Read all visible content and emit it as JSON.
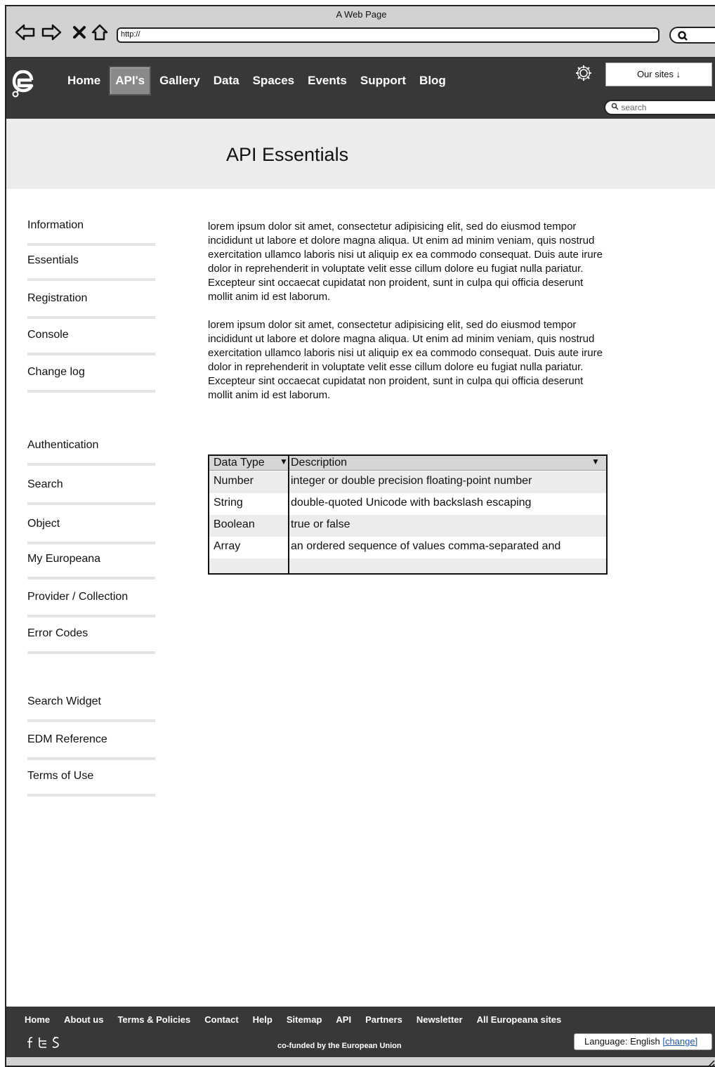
{
  "browser": {
    "window_title": "A Web Page",
    "url": "http://"
  },
  "header": {
    "nav": [
      "Home",
      "API's",
      "Gallery",
      "Data",
      "Spaces",
      "Events",
      "Support",
      "Blog"
    ],
    "active_nav": "API's",
    "our_sites": "Our sites ↓",
    "search_placeholder": "search"
  },
  "page": {
    "title": "API Essentials"
  },
  "sidebar": {
    "items": [
      "Information",
      "Essentials",
      "Registration",
      "Console",
      "Change log",
      "Authentication",
      "Search",
      "Object",
      "My Europeana",
      "Provider / Collection",
      "Error Codes",
      "Search Widget",
      "EDM Reference",
      "Terms of Use"
    ]
  },
  "content": {
    "paragraphs": [
      "lorem ipsum dolor sit amet, consectetur adipisicing elit, sed do eiusmod tempor incididunt ut labore et dolore magna aliqua. Ut enim ad minim veniam, quis nostrud exercitation ullamco laboris nisi ut aliquip ex ea commodo consequat. Duis aute irure dolor in reprehenderit in voluptate velit esse cillum dolore eu fugiat nulla pariatur. Excepteur sint occaecat cupidatat non proident, sunt in culpa qui officia deserunt mollit anim id est laborum.",
      "lorem ipsum dolor sit amet, consectetur adipisicing elit, sed do eiusmod tempor incididunt ut labore et dolore magna aliqua. Ut enim ad minim veniam, quis nostrud exercitation ullamco laboris nisi ut aliquip ex ea commodo consequat. Duis aute irure dolor in reprehenderit in voluptate velit esse cillum dolore eu fugiat nulla pariatur. Excepteur sint occaecat cupidatat non proident, sunt in culpa qui officia deserunt mollit anim id est laborum."
    ]
  },
  "table": {
    "headers": [
      "Data Type",
      "Description"
    ],
    "rows": [
      [
        "Number",
        "integer or double precision floating-point number"
      ],
      [
        "String",
        "double-quoted Unicode with backslash escaping"
      ],
      [
        "Boolean",
        "true or false"
      ],
      [
        "Array",
        "an ordered sequence of values comma-separated and"
      ]
    ]
  },
  "footer": {
    "links": [
      "Home",
      "About us",
      "Terms & Policies",
      "Contact",
      "Help",
      "Sitemap",
      "API",
      "Partners",
      "Newsletter",
      "All Europeana sites"
    ],
    "social_icons": [
      "facebook-icon",
      "twitter-icon",
      "google-plus-icon"
    ],
    "cofunded": "co-funded by the European Union",
    "language_label": "Language: English",
    "language_change": "[change]"
  }
}
